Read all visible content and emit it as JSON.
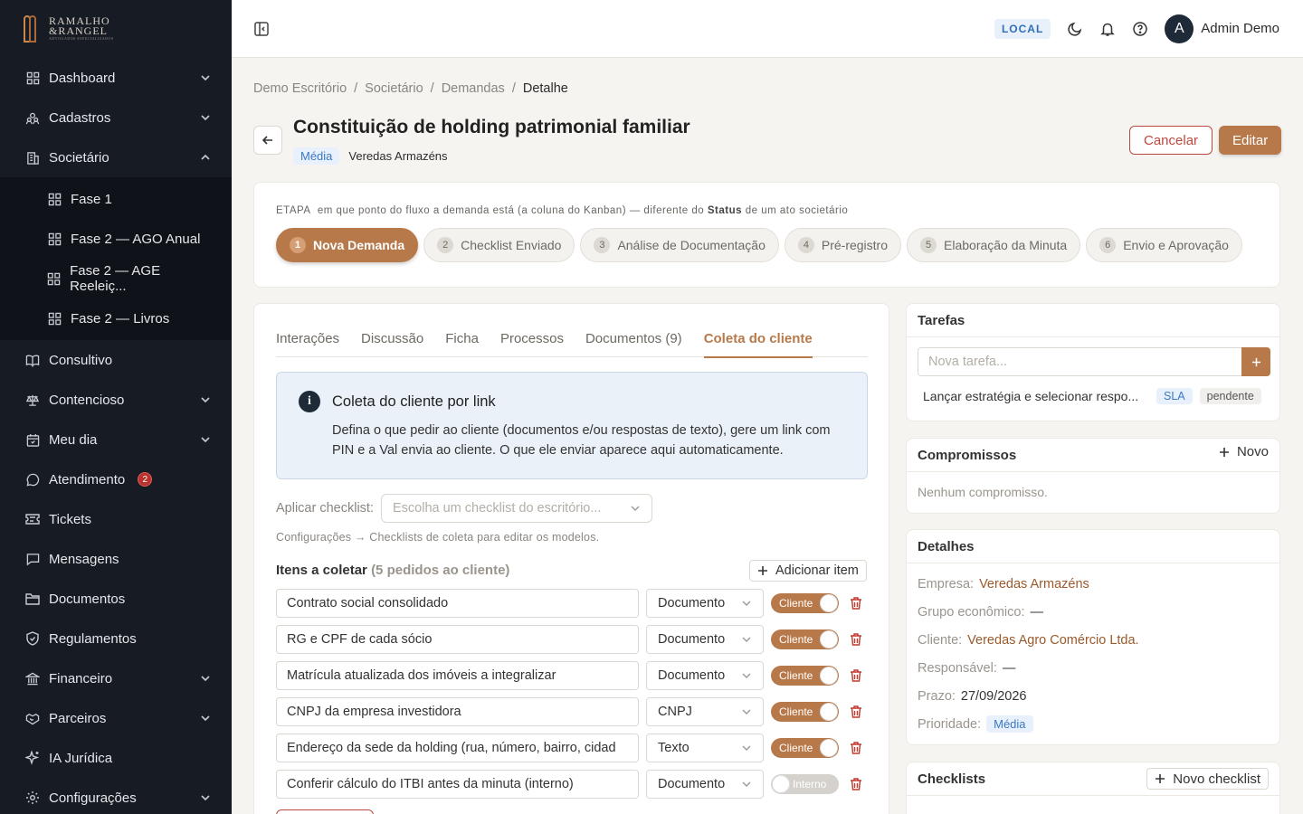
{
  "brand": {
    "name_line1": "RAMALHO",
    "name_line2": "&RANGEL",
    "tagline": "ADVOGADOS ESPECIALIZADOS"
  },
  "sidebar": {
    "items": [
      {
        "label": "Dashboard",
        "icon": "grid-icon",
        "expandable": true
      },
      {
        "label": "Cadastros",
        "icon": "users-icon",
        "expandable": true
      },
      {
        "label": "Societário",
        "icon": "building-icon",
        "expandable": true,
        "expanded": true
      },
      {
        "label": "Consultivo",
        "icon": "book-icon"
      },
      {
        "label": "Contencioso",
        "icon": "scale-icon",
        "expandable": true
      },
      {
        "label": "Meu dia",
        "icon": "calendar-icon",
        "expandable": true
      },
      {
        "label": "Atendimento",
        "icon": "chat-icon",
        "badge": "2"
      },
      {
        "label": "Tickets",
        "icon": "ticket-icon"
      },
      {
        "label": "Mensagens",
        "icon": "message-icon"
      },
      {
        "label": "Documentos",
        "icon": "folder-icon"
      },
      {
        "label": "Regulamentos",
        "icon": "shield-icon"
      },
      {
        "label": "Financeiro",
        "icon": "bank-icon",
        "expandable": true
      },
      {
        "label": "Parceiros",
        "icon": "handshake-icon",
        "expandable": true
      },
      {
        "label": "IA Jurídica",
        "icon": "sparkle-icon"
      },
      {
        "label": "Configurações",
        "icon": "gear-icon",
        "expandable": true
      }
    ],
    "sub_items": [
      {
        "label": "Fase 1"
      },
      {
        "label": "Fase 2 — AGO Anual"
      },
      {
        "label": "Fase 2 — AGE Reeleiç..."
      },
      {
        "label": "Fase 2 — Livros"
      }
    ]
  },
  "topbar": {
    "env": "LOCAL",
    "user_initial": "A",
    "user_name": "Admin Demo"
  },
  "breadcrumb": [
    "Demo Escritório",
    "Societário",
    "Demandas",
    "Detalhe"
  ],
  "page": {
    "title": "Constituição de holding patrimonial familiar",
    "priority_tag": "Média",
    "company_tag": "Veredas Armazéns",
    "cancel_label": "Cancelar",
    "edit_label": "Editar"
  },
  "stage": {
    "hint_prefix": "ETAPA",
    "hint_middle": "em que ponto do fluxo a demanda está (a coluna do Kanban) — diferente do",
    "hint_bold": "Status",
    "hint_suffix": "de um ato societário",
    "steps": [
      {
        "num": "1",
        "label": "Nova Demanda",
        "active": true
      },
      {
        "num": "2",
        "label": "Checklist Enviado"
      },
      {
        "num": "3",
        "label": "Análise de Documentação"
      },
      {
        "num": "4",
        "label": "Pré-registro"
      },
      {
        "num": "5",
        "label": "Elaboração da Minuta"
      },
      {
        "num": "6",
        "label": "Envio e Aprovação"
      }
    ]
  },
  "tabs": [
    {
      "label": "Interações"
    },
    {
      "label": "Discussão"
    },
    {
      "label": "Ficha"
    },
    {
      "label": "Processos"
    },
    {
      "label": "Documentos (9)"
    },
    {
      "label": "Coleta do cliente",
      "active": true
    }
  ],
  "coleta": {
    "info_title": "Coleta do cliente por link",
    "info_text": "Defina o que pedir ao cliente (documentos e/ou respostas de texto), gere um link com PIN e a Val envia ao cliente. O que ele enviar aparece aqui automaticamente.",
    "apply_label": "Aplicar checklist:",
    "apply_placeholder": "Escolha um checklist do escritório...",
    "apply_hint": "Configurações → Checklists de coleta para editar os modelos.",
    "items_title": "Itens a coletar",
    "items_count": "(5 pedidos ao cliente)",
    "add_item_label": "Adicionar item",
    "items": [
      {
        "text": "Contrato social consolidado",
        "type": "Documento",
        "scope": "Cliente",
        "on": true
      },
      {
        "text": "RG e CPF de cada sócio",
        "type": "Documento",
        "scope": "Cliente",
        "on": true
      },
      {
        "text": "Matrícula atualizada dos imóveis a integralizar",
        "type": "Documento",
        "scope": "Cliente",
        "on": true
      },
      {
        "text": "CNPJ da empresa investidora",
        "type": "CNPJ",
        "scope": "Cliente",
        "on": true
      },
      {
        "text": "Endereço da sede da holding (rua, número, bairro, cidad",
        "type": "Texto",
        "scope": "Cliente",
        "on": true
      },
      {
        "text": "Conferir cálculo do ITBI antes da minuta (interno)",
        "type": "Documento",
        "scope": "Interno",
        "on": false
      }
    ]
  },
  "tarefas": {
    "title": "Tarefas",
    "input_placeholder": "Nova tarefa...",
    "items": [
      {
        "label": "Lançar estratégia e selecionar respo...",
        "chip1": "SLA",
        "chip2": "pendente"
      }
    ]
  },
  "compromissos": {
    "title": "Compromissos",
    "new_label": "Novo",
    "empty": "Nenhum compromisso."
  },
  "detalhes": {
    "title": "Detalhes",
    "rows": [
      {
        "key": "Empresa:",
        "value": "Veredas Armazéns",
        "link": true
      },
      {
        "key": "Grupo econômico:",
        "value": "—"
      },
      {
        "key": "Cliente:",
        "value": "Veredas Agro Comércio Ltda.",
        "link": true
      },
      {
        "key": "Responsável:",
        "value": "—"
      },
      {
        "key": "Prazo:",
        "value": "27/09/2026"
      },
      {
        "key": "Prioridade:",
        "value": "Média",
        "tag": true
      }
    ]
  },
  "checklists": {
    "title": "Checklists",
    "new_label": "Novo checklist"
  },
  "colors": {
    "accent": "#b7794a",
    "sidebar": "#161b24",
    "danger": "#b94a3f",
    "info_bg": "#eaf1f8"
  }
}
